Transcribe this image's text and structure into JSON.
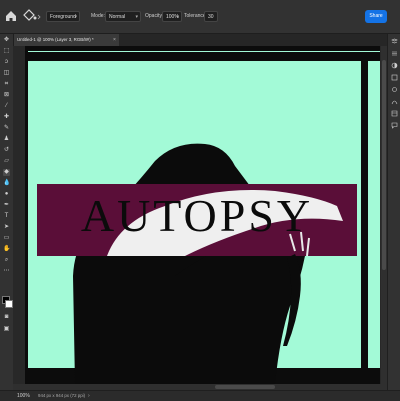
{
  "options_bar": {
    "sample_select": "Foreground",
    "mode_label": "Mode:",
    "mode_value": "Normal",
    "opacity_label": "Opacity:",
    "opacity_value": "100%",
    "tolerance_label": "Tolerance:",
    "tolerance_value": "30",
    "share_label": "Share"
  },
  "document": {
    "tab_title": "Untitled-1 @ 100% (Layer 3, RGB/8#) *",
    "tab_close": "×"
  },
  "canvas": {
    "headline": "AUTOPSY",
    "background_color": "#a3fad7",
    "band_color": "#5a0e38"
  },
  "status_bar": {
    "zoom": "100%",
    "dimensions": "944 px x 944 px (72 ppi)",
    "arrow": "›"
  }
}
